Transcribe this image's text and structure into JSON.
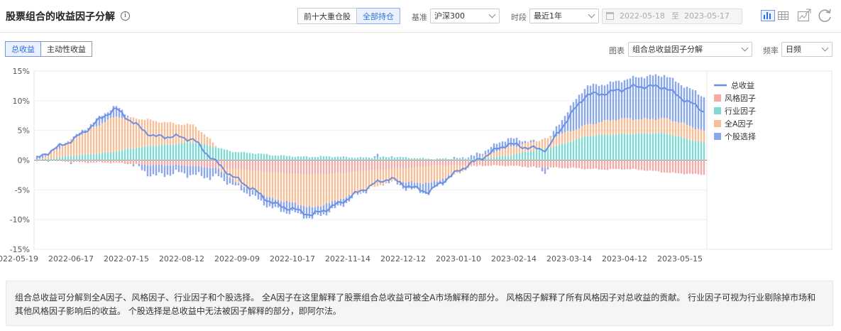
{
  "header": {
    "title": "股票组合的收益因子分解",
    "info_icon": "info-icon",
    "holding_tabs": [
      {
        "label": "前十大重仓股",
        "active": false
      },
      {
        "label": "全部持仓",
        "active": true
      }
    ],
    "benchmark_label": "基准",
    "benchmark_value": "沪深300",
    "period_label": "时段",
    "period_value": "最近1年",
    "date_start": "2022-05-18",
    "date_sep": "至",
    "date_end": "2023-05-17",
    "tools": [
      "bar-chart-icon",
      "table-icon",
      "export-image-icon",
      "refresh-icon"
    ]
  },
  "toolbar": {
    "return_tabs": [
      {
        "label": "总收益",
        "active": true
      },
      {
        "label": "主动性收益",
        "active": false
      }
    ],
    "chart_label": "图表",
    "chart_value": "组合总收益因子分解",
    "freq_label": "频率",
    "freq_value": "日频"
  },
  "colors": {
    "total": "#6f8fe0",
    "style": "#f5aaa8",
    "industry": "#7fd9d4",
    "market": "#f8be96",
    "stock": "#8aa8ee"
  },
  "chart_data": {
    "type": "bar",
    "stacked": true,
    "x_tick_labels": [
      "2022-05-19",
      "2022-06-17",
      "2022-07-15",
      "2022-08-12",
      "2022-09-09",
      "2022-10-17",
      "2022-11-14",
      "2022-12-12",
      "2023-01-10",
      "2023-02-14",
      "2023-03-14",
      "2023-04-12",
      "2023-05-15"
    ],
    "ylim": [
      -15,
      15
    ],
    "y_ticks": [
      "15%",
      "10%",
      "5%",
      "0%",
      "-5%",
      "-10%",
      "-15%"
    ],
    "y_unit": "%",
    "grid": "horizontal",
    "legend_position": "right",
    "legend": [
      "总收益",
      "风格因子",
      "行业因子",
      "全A因子",
      "个股选择"
    ],
    "keypoints": {
      "total": [
        0,
        4,
        8.5,
        4,
        3.5,
        -3,
        -7,
        -9.5,
        -6,
        -3,
        -5.5,
        -0.5,
        2.5,
        2,
        11,
        12,
        12.5,
        8
      ],
      "market": [
        0,
        3,
        6,
        4,
        3,
        -2,
        -4.5,
        -5.5,
        -4,
        -2,
        -3,
        -0.5,
        1.5,
        1.5,
        2,
        2.5,
        2.5,
        2
      ],
      "industry": [
        0,
        0.8,
        1.5,
        2.5,
        3,
        1.5,
        0.8,
        0.6,
        0.5,
        0.5,
        0.3,
        0.2,
        0.8,
        2,
        4,
        4.5,
        4.5,
        3
      ],
      "style": [
        0,
        -0.3,
        -0.5,
        -0.8,
        -1,
        -1.5,
        -2,
        -2.5,
        -2,
        -1.5,
        -1,
        -0.8,
        -1,
        -1.2,
        -1.5,
        -1.5,
        -2,
        -2.5
      ]
    }
  },
  "description": "组合总收益可分解到全A因子、风格因子、行业因子和个股选择。 全A因子在这里解释了股票组合总收益可被全A市场解释的部分。 风格因子解释了所有风格因子对总收益的贡献。 行业因子可视为行业剔除掉市场和其他风格因子影响后的收益。 个股选择是总收益中无法被因子解释的部分，即阿尔法。"
}
